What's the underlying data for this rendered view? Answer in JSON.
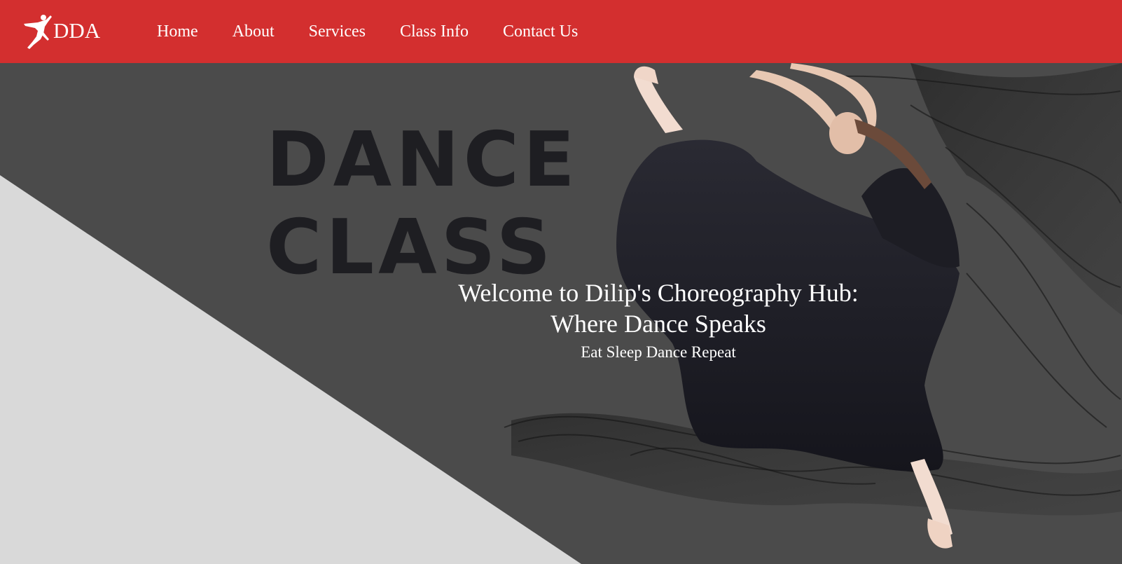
{
  "brand": {
    "name": "DDA",
    "logo_icon": "dancer-logo-icon"
  },
  "nav": {
    "items": [
      {
        "label": "Home"
      },
      {
        "label": "About"
      },
      {
        "label": "Services"
      },
      {
        "label": "Class Info"
      },
      {
        "label": "Contact Us"
      }
    ]
  },
  "hero": {
    "graphic_words": [
      "DANCE",
      "CLASS"
    ],
    "title_line1": "Welcome to Dilip's Choreography Hub:",
    "title_line2": "Where Dance Speaks",
    "subtitle": "Eat Sleep Dance Repeat"
  },
  "colors": {
    "navbar": "#d32f2f",
    "hero_dark": "#4b4b4b",
    "hero_light": "#d9d9d9",
    "text": "#ffffff"
  }
}
